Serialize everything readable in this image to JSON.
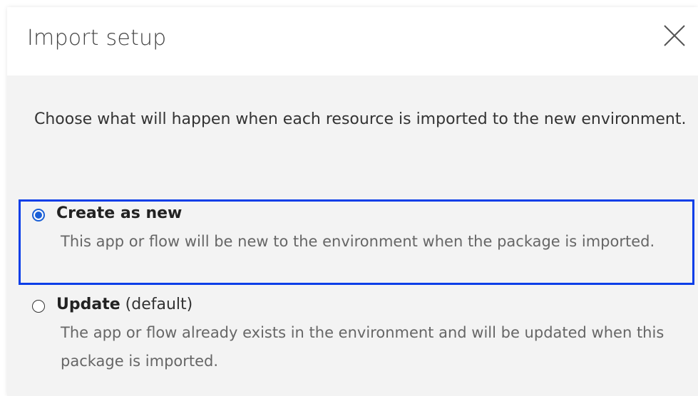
{
  "dialog": {
    "title": "Import setup",
    "close_icon": "close-icon",
    "description": "Choose what will happen when each resource is imported to the new environment.",
    "accent_color": "#0a3ee8",
    "options": [
      {
        "label": "Create as new",
        "suffix": "",
        "description": "This app or flow will be new to the environment when the package is imported.",
        "selected": true
      },
      {
        "label": "Update",
        "suffix": "(default)",
        "description": "The app or flow already exists in the environment and will be updated when this package is imported.",
        "selected": false
      }
    ]
  }
}
